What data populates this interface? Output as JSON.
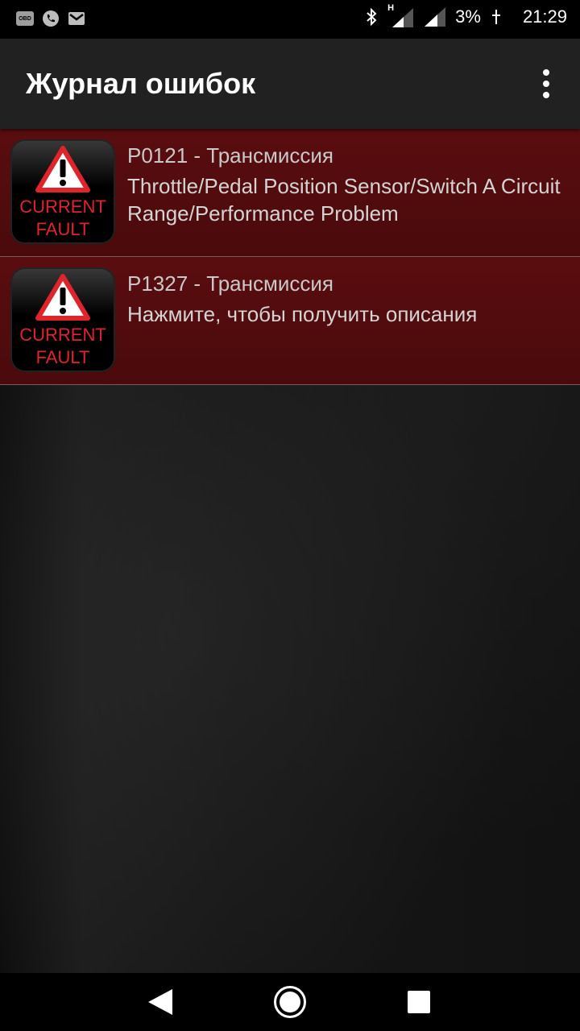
{
  "status_bar": {
    "obd_label": "OBD",
    "network_label": "H",
    "battery": "3%",
    "time": "21:29"
  },
  "app_bar": {
    "title": "Журнал ошибок"
  },
  "faults": [
    {
      "code": "P0121 - Трансмиссия",
      "description": "Throttle/Pedal Position Sensor/Switch A Circuit Range/Performance Problem",
      "badge_line1": "CURRENT",
      "badge_line2": "FAULT"
    },
    {
      "code": "P1327 - Трансмиссия",
      "description": "Нажмите, чтобы получить описания",
      "badge_line1": "CURRENT",
      "badge_line2": "FAULT"
    }
  ],
  "colors": {
    "row_background": "#4e0b0d",
    "badge_text": "#e0242c",
    "app_bar": "#212121"
  }
}
